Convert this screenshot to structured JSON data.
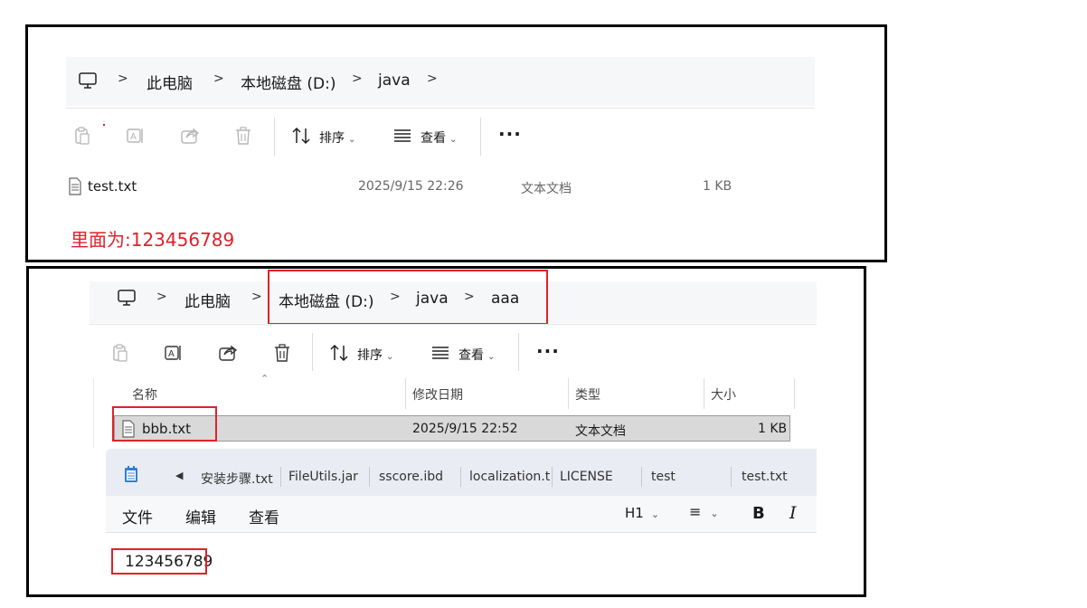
{
  "top": {
    "breadcrumb": [
      "此电脑",
      "本地磁盘 (D:)",
      "java"
    ],
    "toolbar": {
      "sort_label": "排序",
      "view_label": "查看"
    },
    "file": {
      "name": "test.txt",
      "modified": "2025/9/15 22:26",
      "type": "文本文档",
      "size": "1 KB"
    },
    "note": "里面为:123456789"
  },
  "bottom": {
    "breadcrumb": [
      "此电脑",
      "本地磁盘 (D:)",
      "java",
      "aaa"
    ],
    "toolbar": {
      "sort_label": "排序",
      "view_label": "查看"
    },
    "columns": [
      "名称",
      "修改日期",
      "类型",
      "大小"
    ],
    "file": {
      "name": "bbb.txt",
      "modified": "2025/9/15 22:52",
      "type": "文本文档",
      "size": "1 KB"
    },
    "notepad": {
      "tabs": [
        "安装步骤.txt",
        "FileUtils.jar",
        "sscore.ibd",
        "localization.t",
        "LICENSE",
        "test",
        "test.txt"
      ],
      "menu": [
        "文件",
        "编辑",
        "查看"
      ],
      "heading_label": "H1",
      "content": "123456789"
    }
  },
  "colors": {
    "highlight": "#e0212a",
    "note_text": "#e0212a",
    "selected_row": "#d9d9d9"
  }
}
